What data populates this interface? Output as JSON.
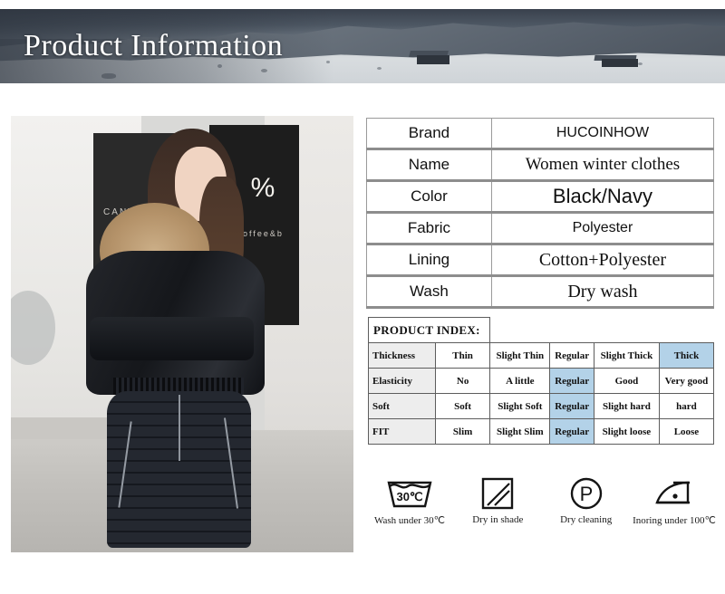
{
  "banner": {
    "title": "Product Information"
  },
  "photo": {
    "alt": "model-wearing-black-hooded-fur-trim-snowsuit",
    "storefront_logo": "%",
    "storefront_text": "coffee&b",
    "storefront_sign": "CANVA"
  },
  "spec_table": {
    "rows": [
      {
        "key": "Brand",
        "value": "HUCOINHOW"
      },
      {
        "key": "Name",
        "value": "Women winter clothes"
      },
      {
        "key": "Color",
        "value": "Black/Navy"
      },
      {
        "key": "Fabric",
        "value": "Polyester"
      },
      {
        "key": "Lining",
        "value": "Cotton+Polyester"
      },
      {
        "key": "Wash",
        "value": "Dry wash"
      }
    ]
  },
  "product_index": {
    "header": "PRODUCT INDEX:",
    "rows": [
      {
        "label": "Thickness",
        "cells": [
          "Thin",
          "Slight Thin",
          "Regular",
          "Slight Thick",
          "Thick"
        ],
        "highlight": 4
      },
      {
        "label": "Elasticity",
        "cells": [
          "No",
          "A little",
          "Regular",
          "Good",
          "Very good"
        ],
        "highlight": 2
      },
      {
        "label": "Soft",
        "cells": [
          "Soft",
          "Slight Soft",
          "Regular",
          "Slight hard",
          "hard"
        ],
        "highlight": 2
      },
      {
        "label": "FIT",
        "cells": [
          "Slim",
          "Slight Slim",
          "Regular",
          "Slight loose",
          "Loose"
        ],
        "highlight": 2
      }
    ]
  },
  "care_icons": [
    {
      "icon": "wash-tub-icon",
      "temp": "30℃",
      "caption": "Wash under 30℃"
    },
    {
      "icon": "dry-in-shade-icon",
      "temp": "",
      "caption": "Dry in shade"
    },
    {
      "icon": "dry-clean-p-icon",
      "temp": "P",
      "caption": "Dry cleaning"
    },
    {
      "icon": "iron-one-dot-icon",
      "temp": "",
      "caption": "Inoring under 100℃"
    }
  ],
  "colors": {
    "highlight_blue": "#b3d2e8",
    "row_label_gray": "#ededed",
    "divider_gray": "#8d8d8d",
    "banner_dark": "#39414d"
  }
}
